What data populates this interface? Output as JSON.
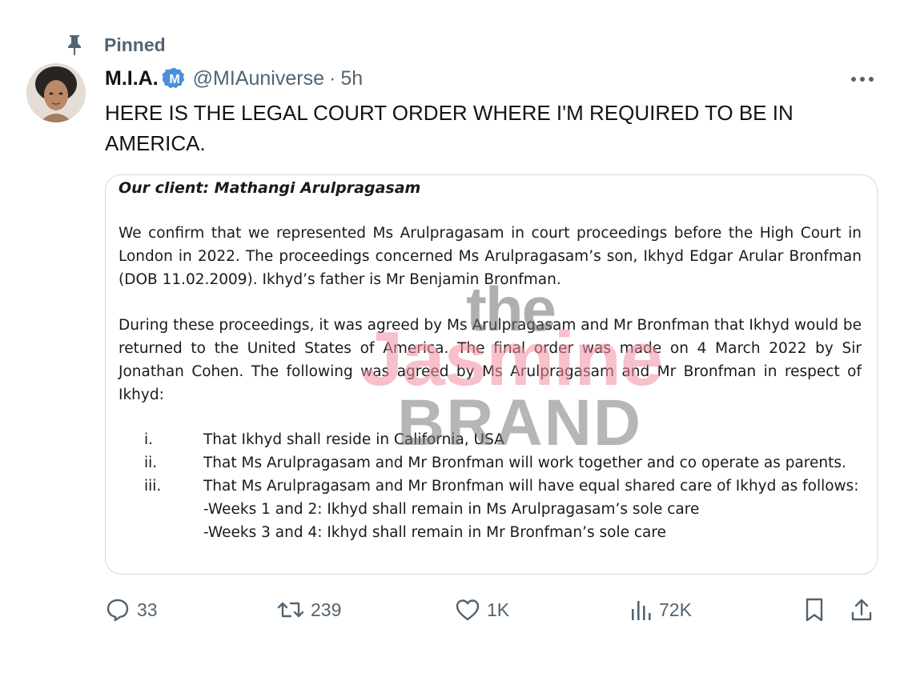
{
  "pinned": {
    "label": "Pinned"
  },
  "author": {
    "display_name": "M.I.A.",
    "handle": "@MIAuniverse",
    "separator": "·",
    "time": "5h",
    "verified_letter": "M"
  },
  "tweet": {
    "text": "HERE IS THE LEGAL COURT ORDER WHERE I'M REQUIRED TO BE IN AMERICA."
  },
  "document": {
    "title": "Our client: Mathangi Arulpragasam",
    "paragraph_1": "We confirm that we represented Ms Arulpragasam in court proceedings before the High Court in London in 2022. The proceedings concerned Ms Arulpragasam’s son, Ikhyd Edgar Arular Bronfman (DOB 11.02.2009). Ikhyd’s father is Mr Benjamin Bronfman.",
    "paragraph_2": "During these proceedings, it was agreed by Ms Arulpragasam and Mr Bronfman that Ikhyd would be returned to the United States of America. The final order was made on 4 March 2022 by Sir Jonathan Cohen. The following was agreed by Ms Arulpragasam and Mr Bronfman in respect of Ikhyd:",
    "items": [
      {
        "num": "i.",
        "text": "That Ikhyd shall reside in California, USA"
      },
      {
        "num": "ii.",
        "text": "That Ms Arulpragasam and Mr Bronfman will work together and co operate as parents."
      },
      {
        "num": "iii.",
        "text": "That Ms Arulpragasam and Mr Bronfman will have equal shared care of Ikhyd as follows:"
      }
    ],
    "sub_item": "-Weeks 1 and 2: Ikhyd shall remain in Ms Arulpragasam’s sole care",
    "cut_line": "-Weeks 3 and 4: Ikhyd shall remain in Mr Bronfman’s sole care"
  },
  "watermark": {
    "line1": "the",
    "line2": "Jasmine",
    "line3": "BRAND"
  },
  "actions": {
    "replies": "33",
    "reposts": "239",
    "likes": "1K",
    "views": "72K"
  },
  "icons": {
    "pin": "pin-icon",
    "verified": "verified-badge-icon",
    "more": "more-icon",
    "reply": "reply-icon",
    "repost": "repost-icon",
    "like": "heart-icon",
    "views": "views-icon",
    "bookmark": "bookmark-icon",
    "share": "share-icon"
  },
  "colors": {
    "text_primary": "#0f1419",
    "text_secondary": "#536471",
    "verified_blue": "#4a90d9",
    "card_border": "#cfd9de",
    "watermark_pink": "#f08ca0"
  }
}
